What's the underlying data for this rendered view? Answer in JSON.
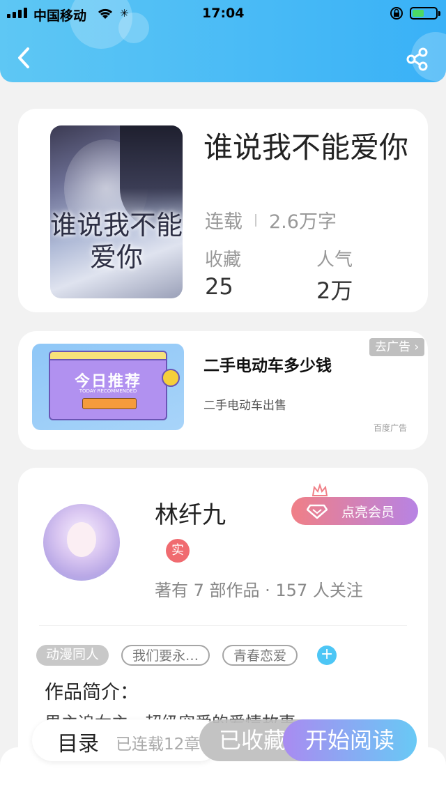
{
  "status_bar": {
    "carrier": "中国移动",
    "time": "17:04"
  },
  "book": {
    "title": "谁说我不能爱你",
    "cover_text": "谁说我不能爱你",
    "status": "连载",
    "word_count": "2.6万字",
    "favorites_label": "收藏",
    "favorites_value": "25",
    "popularity_label": "人气",
    "popularity_value": "2万"
  },
  "ad": {
    "title": "二手电动车多少钱",
    "subtitle": "二手电动车出售",
    "remove_label": "去广告 ›",
    "badge": "百度广告",
    "image_text": "今日推荐",
    "image_subtext": "TODAY RECOMMENDED"
  },
  "author": {
    "name": "林纤九",
    "verified_label": "实",
    "member_button": "点亮会员",
    "stats": "著有 7 部作品 · 157 人关注",
    "tags": [
      "动漫同人",
      "我们要永…",
      "青春恋爱"
    ],
    "intro_title": "作品简介：",
    "intro_text": "男主追女主，超级宠爱的爱情故事"
  },
  "bottom_bar": {
    "toc_label": "目录",
    "serial_status": "已连载12章",
    "collected_label": "已收藏",
    "read_button": "开始阅读"
  },
  "colors": {
    "header_start": "#5ec7f4",
    "header_end": "#39b1f7",
    "member_start": "#f07f86",
    "member_end": "#b783e4",
    "read_start": "#a98bf1",
    "read_end": "#68c9f5",
    "verify": "#f06b70"
  },
  "icons": [
    "back-arrow-icon",
    "share-icon",
    "wifi-icon",
    "battery-icon",
    "crown-icon",
    "diamond-icon",
    "plus-icon"
  ]
}
